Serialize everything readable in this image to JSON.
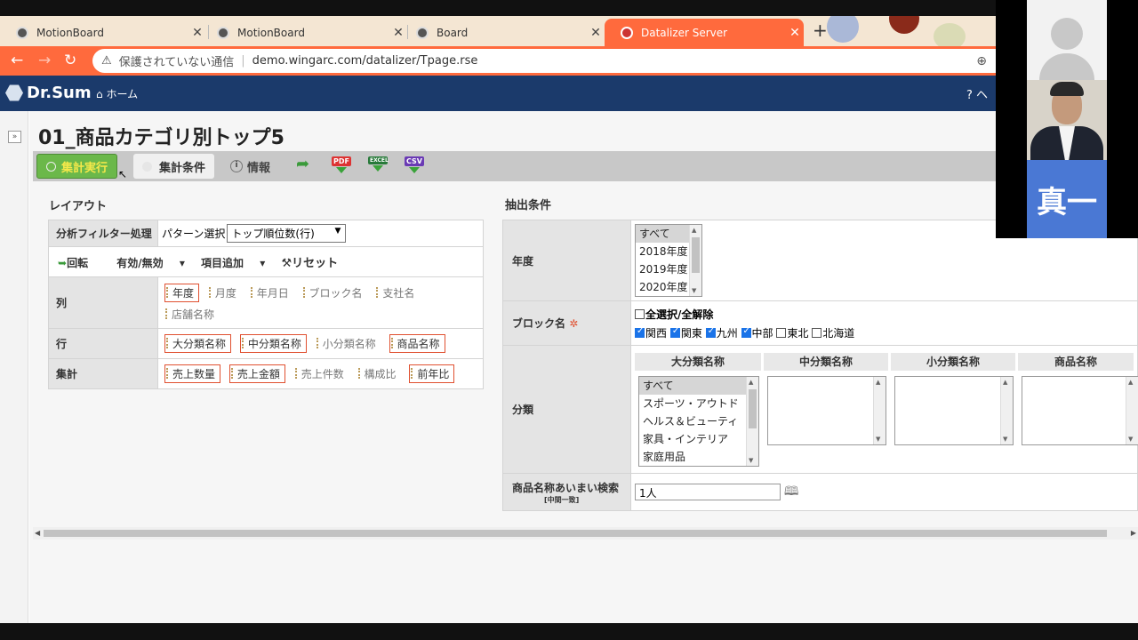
{
  "browser": {
    "tabs": [
      {
        "label": "MotionBoard"
      },
      {
        "label": "MotionBoard"
      },
      {
        "label": "Board"
      },
      {
        "label": "Datalizer Server"
      }
    ],
    "security_text": "保護されていない通信",
    "url": "demo.wingarc.com/datalizer/Tpage.rse"
  },
  "app": {
    "logo": "Dr.Sum",
    "home_label": "ホーム",
    "help_label": "ヘ"
  },
  "page": {
    "title": "01_商品カテゴリ別トップ5"
  },
  "toolbar": {
    "run_label": "集計実行",
    "conditions_label": "集計条件",
    "info_label": "情報",
    "pdf_label": "PDF",
    "excel_label": "EXCEL",
    "csv_label": "CSV"
  },
  "layout": {
    "section_title": "レイアウト",
    "filter_row_label": "分析フィルター処理",
    "pattern_label": "パターン選択",
    "pattern_value": "トップ順位数(行)",
    "actions": {
      "rotate": "回転",
      "toggle": "有効/無効",
      "add_item": "項目追加",
      "reset": "リセット"
    },
    "rows": [
      {
        "label": "列",
        "chips": [
          {
            "text": "年度",
            "on": true
          },
          {
            "text": "月度",
            "on": false
          },
          {
            "text": "年月日",
            "on": false
          },
          {
            "text": "ブロック名",
            "on": false
          },
          {
            "text": "支社名",
            "on": false
          },
          {
            "text": "店舗名称",
            "on": false
          }
        ]
      },
      {
        "label": "行",
        "chips": [
          {
            "text": "大分類名称",
            "on": true
          },
          {
            "text": "中分類名称",
            "on": true
          },
          {
            "text": "小分類名称",
            "on": false
          },
          {
            "text": "商品名称",
            "on": true
          }
        ]
      },
      {
        "label": "集計",
        "chips": [
          {
            "text": "売上数量",
            "on": true
          },
          {
            "text": "売上金額",
            "on": true
          },
          {
            "text": "売上件数",
            "on": false
          },
          {
            "text": "構成比",
            "on": false
          },
          {
            "text": "前年比",
            "on": true
          }
        ]
      }
    ]
  },
  "filters": {
    "section_title": "抽出条件",
    "year": {
      "label": "年度",
      "options": [
        "すべて",
        "2018年度",
        "2019年度",
        "2020年度"
      ],
      "selected": "すべて"
    },
    "block": {
      "label": "ブロック名",
      "select_all": "全選択/全解除",
      "items": [
        {
          "text": "関西",
          "checked": true
        },
        {
          "text": "関東",
          "checked": true
        },
        {
          "text": "九州",
          "checked": true
        },
        {
          "text": "中部",
          "checked": true
        },
        {
          "text": "東北",
          "checked": false
        },
        {
          "text": "北海道",
          "checked": false
        }
      ]
    },
    "category": {
      "label": "分類",
      "headers": [
        "大分類名称",
        "中分類名称",
        "小分類名称",
        "商品名称"
      ],
      "major_options": [
        "すべて",
        "スポーツ・アウトド",
        "ヘルス＆ビューティ",
        "家具・インテリア",
        "家庭用品"
      ]
    },
    "search": {
      "label": "商品名称あいまい検索",
      "sublabel": "[中間一致]",
      "value": "1人"
    }
  },
  "webcam": {
    "name_tile": "真一"
  },
  "colors": {
    "accent": "#ff6a3d",
    "header": "#1b3a6b",
    "run_button": "#6bb84a",
    "chip_border": "#e05030"
  }
}
